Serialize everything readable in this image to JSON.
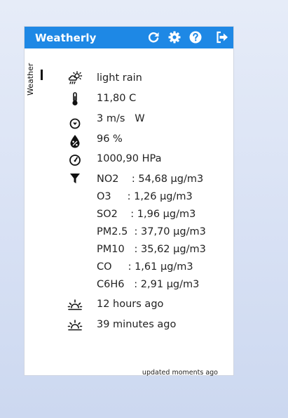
{
  "app": {
    "title": "Weatherly"
  },
  "toolbar": {
    "icons": [
      "refresh-icon",
      "gear-icon",
      "help-icon",
      "sign-out-icon"
    ]
  },
  "sidebar": {
    "tab_label": "Weather"
  },
  "weather": {
    "condition": "light rain",
    "temperature": "11,80 C",
    "wind": "3 m/s   W",
    "humidity": "96 %",
    "pressure": "1000,90 HPa",
    "pollutants": [
      "NO2    : 54,68 µg/m3",
      "O3     : 1,26 µg/m3",
      "SO2    : 1,96 µg/m3",
      "PM2.5  : 37,70 µg/m3",
      "PM10   : 35,62 µg/m3",
      "CO     : 1,61 µg/m3",
      "C6H6   : 2,91 µg/m3"
    ],
    "sunrise": "12 hours ago",
    "sunset": "39 minutes ago"
  },
  "status": {
    "updated": "updated moments ago"
  },
  "colors": {
    "titlebar": "#1e88e5",
    "background": "#dde5f5"
  }
}
